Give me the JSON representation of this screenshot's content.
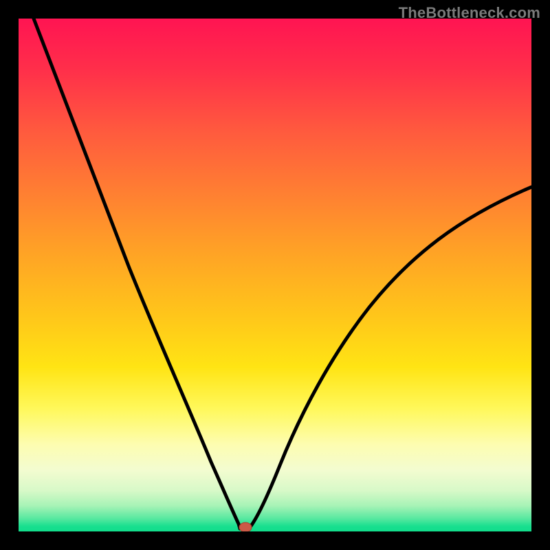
{
  "watermark": "TheBottleneck.com",
  "colors": {
    "frame": "#000000",
    "curve": "#000000",
    "marker_fill": "#cc5a47",
    "marker_stroke": "#a8402f",
    "gradient_top": "#ff1452",
    "gradient_bottom": "#12dd8c"
  },
  "chart_data": {
    "type": "line",
    "title": "",
    "xlabel": "",
    "ylabel": "",
    "xlim": [
      0,
      100
    ],
    "ylim": [
      0,
      100
    ],
    "grid": false,
    "legend": false,
    "curve_note": "V-shaped bottleneck curve. x is parameter sweep (percent), y is bottleneck severity (percent). Minimum near x≈44.",
    "x": [
      0,
      3,
      7,
      12,
      17,
      22,
      27,
      30,
      33,
      36,
      38,
      40,
      41,
      42,
      43,
      44,
      45,
      46,
      47,
      49,
      52,
      56,
      61,
      67,
      74,
      82,
      90,
      100
    ],
    "y": [
      null,
      100,
      90,
      78,
      66,
      54,
      42,
      35,
      28,
      21,
      15,
      10,
      7,
      4,
      2,
      1,
      1,
      2,
      4,
      8,
      14,
      22,
      31,
      40,
      48,
      55,
      61,
      67
    ],
    "marker": {
      "x": 44,
      "y": 1
    }
  }
}
